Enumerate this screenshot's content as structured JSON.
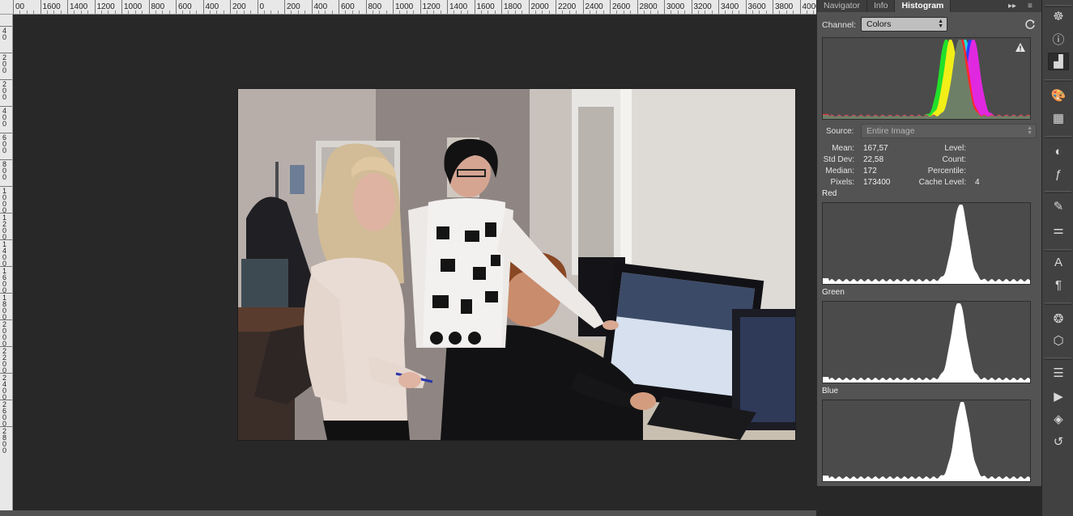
{
  "ruler": {
    "top_labels": [
      "00",
      "1600",
      "1400",
      "1200",
      "1000",
      "800",
      "600",
      "400",
      "200",
      "0",
      "200",
      "400",
      "600",
      "800",
      "1000",
      "1200",
      "1400",
      "1600",
      "1800",
      "2000",
      "2200",
      "2400",
      "2600",
      "2800",
      "3000",
      "3200",
      "3400",
      "3600",
      "3800",
      "4000"
    ],
    "left_labels": [
      "4 0",
      "2 0 0",
      "2 0 0",
      "4 0 0",
      "6 0 0",
      "8 0 0",
      "1 0 0 0",
      "1 2 0 0",
      "1 4 0 0",
      "1 6 0 0",
      "1 8 0 0",
      "2 0 0 0",
      "2 2 0 0",
      "2 4 0 0",
      "2 6 0 0",
      "2 8 0 0"
    ]
  },
  "panel": {
    "tabs": [
      {
        "label": "Navigator",
        "active": false
      },
      {
        "label": "Info",
        "active": false
      },
      {
        "label": "Histogram",
        "active": true
      }
    ],
    "collapse_glyph": "▸▸",
    "menu_glyph": "≡",
    "channel_label": "Channel:",
    "channel_value": "Colors",
    "source_label": "Source:",
    "source_value": "Entire Image",
    "stats_left": [
      {
        "label": "Mean:",
        "value": "167,57"
      },
      {
        "label": "Std Dev:",
        "value": "22,58"
      },
      {
        "label": "Median:",
        "value": "172"
      },
      {
        "label": "Pixels:",
        "value": "173400"
      }
    ],
    "stats_right": [
      {
        "label": "Level:",
        "value": ""
      },
      {
        "label": "Count:",
        "value": ""
      },
      {
        "label": "Percentile:",
        "value": ""
      },
      {
        "label": "Cache Level:",
        "value": "4"
      }
    ],
    "channels": [
      {
        "label": "Red"
      },
      {
        "label": "Green"
      },
      {
        "label": "Blue"
      }
    ],
    "colors": {
      "composite_fill": "#6e7f68",
      "red": "#ff2a2a",
      "green": "#22e02a",
      "blue": "#2a3cff",
      "yellow": "#f2ee18",
      "cyan": "#1ce0e0",
      "magenta": "#e028e0"
    }
  },
  "toolbar_icons": [
    "compass-icon",
    "info-icon",
    "histogram-icon",
    "palette-icon",
    "swatches-icon",
    "adjustments-icon",
    "styles-icon",
    "brush-icon",
    "brush-presets-icon",
    "character-icon",
    "paragraph-icon",
    "channels-icon",
    "paths-icon",
    "properties-icon",
    "actions-icon",
    "layers-icon",
    "history-icon"
  ],
  "photo": {
    "description_icon": "photo-canvas"
  }
}
